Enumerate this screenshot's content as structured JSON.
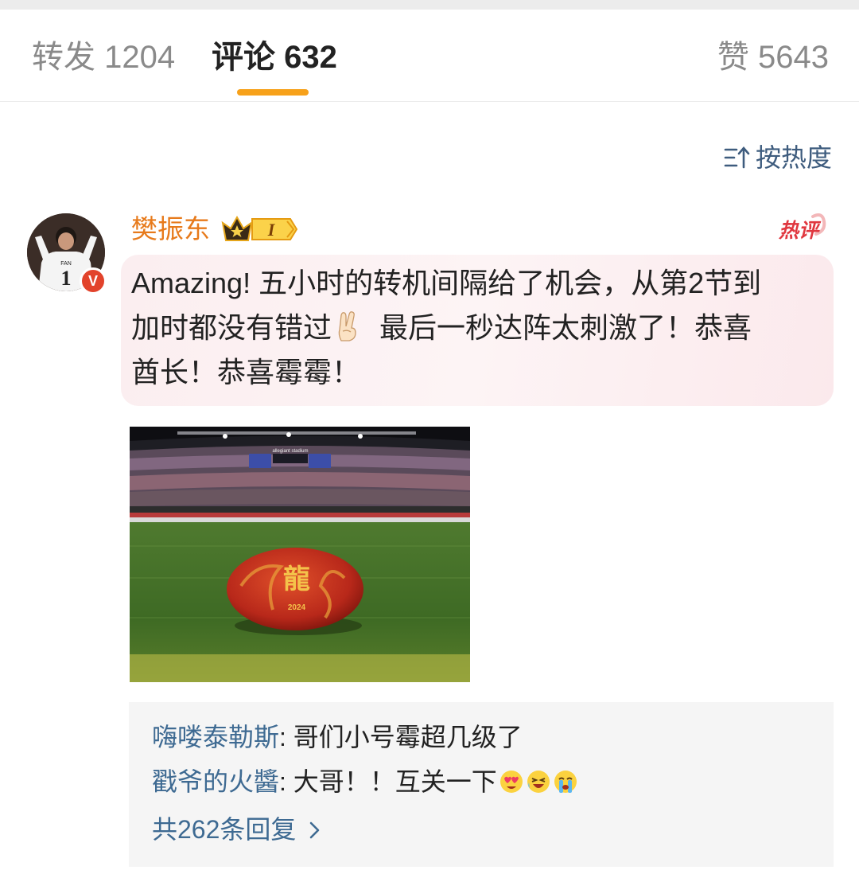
{
  "tabs": [
    {
      "label": "转发",
      "count": "1204"
    },
    {
      "label": "评论",
      "count": "632"
    },
    {
      "label": "赞",
      "count": "5643"
    }
  ],
  "sort": {
    "label": "按热度",
    "icon": "sort-icon"
  },
  "comment": {
    "username": "樊振东",
    "level": "I",
    "hot_tag": "热评",
    "text_lines": [
      "Amazing! 五小时的转机间隔给了机会，从第2节到",
      "加时都没有错过",
      " 最后一秒达阵太刺激了！恭喜",
      "酋长！恭喜霉霉！"
    ],
    "photo": {
      "stadium_label": "allegiant stadium",
      "ball_char": "龍",
      "ball_year": "2024"
    }
  },
  "replies": [
    {
      "name": "嗨喽泰勒斯",
      "text": "哥们小号霉超几级了"
    },
    {
      "name": "戳爷的火醬",
      "text": "大哥！！互关一下"
    }
  ],
  "more_replies": "共262条回复",
  "colors": {
    "accent": "#f7a11a",
    "username": "#e77a1b",
    "link": "#3e6a92",
    "hot": "#e0373f"
  }
}
